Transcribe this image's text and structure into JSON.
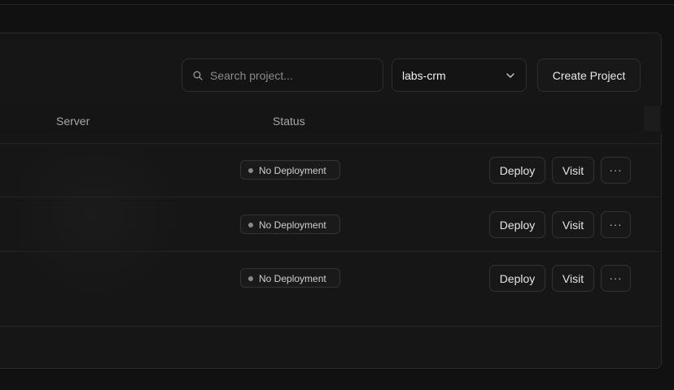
{
  "toolbar": {
    "search_placeholder": "Search project...",
    "select_value": "labs-crm",
    "create_label": "Create Project"
  },
  "table": {
    "columns": [
      "Server",
      "Status"
    ],
    "rows": [
      {
        "status": "No Deployment",
        "deploy_label": "Deploy",
        "visit_label": "Visit",
        "more_label": "···"
      },
      {
        "status": "No Deployment",
        "deploy_label": "Deploy",
        "visit_label": "Visit",
        "more_label": "···"
      },
      {
        "status": "No Deployment",
        "deploy_label": "Deploy",
        "visit_label": "Visit",
        "more_label": "···"
      }
    ]
  },
  "icons": {
    "search": "search-icon",
    "chevron": "chevron-down-icon",
    "status_dot": "status-dot-icon"
  },
  "colors": {
    "background": "#111111",
    "panel": "#161616",
    "border": "#2e2e2e",
    "status_dot": "#8a8a8a"
  }
}
